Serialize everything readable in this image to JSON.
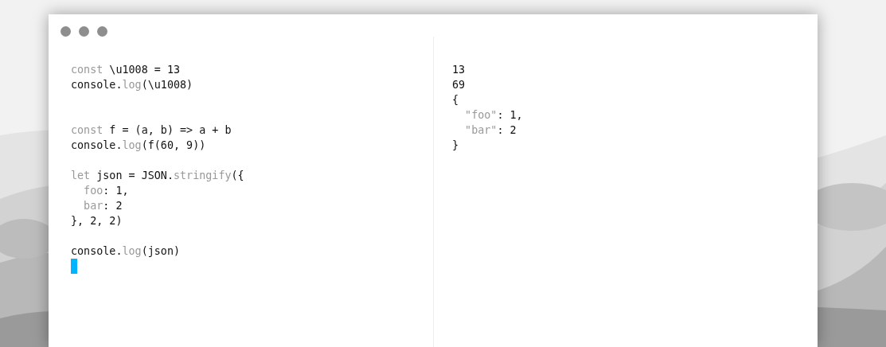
{
  "window": {
    "controls": [
      {
        "kind": "dot"
      },
      {
        "kind": "dot"
      },
      {
        "kind": "dot"
      }
    ]
  },
  "editor": {
    "lines": [
      {
        "kind": "code",
        "segments": [
          {
            "text": "const",
            "kind": "dim"
          },
          {
            "text": " \\u1008 = 13",
            "kind": "plain"
          }
        ]
      },
      {
        "kind": "code",
        "segments": [
          {
            "text": "console.",
            "kind": "plain"
          },
          {
            "text": "log",
            "kind": "dim"
          },
          {
            "text": "(\\u1008)",
            "kind": "plain"
          }
        ]
      },
      {
        "kind": "blank"
      },
      {
        "kind": "blank"
      },
      {
        "kind": "code",
        "segments": [
          {
            "text": "const",
            "kind": "dim"
          },
          {
            "text": " f = (a, b) => a + b",
            "kind": "plain"
          }
        ]
      },
      {
        "kind": "code",
        "segments": [
          {
            "text": "console.",
            "kind": "plain"
          },
          {
            "text": "log",
            "kind": "dim"
          },
          {
            "text": "(f(60, 9))",
            "kind": "plain"
          }
        ]
      },
      {
        "kind": "blank"
      },
      {
        "kind": "code",
        "segments": [
          {
            "text": "let",
            "kind": "dim"
          },
          {
            "text": " json = JSON.",
            "kind": "plain"
          },
          {
            "text": "stringify",
            "kind": "dim"
          },
          {
            "text": "({",
            "kind": "plain"
          }
        ]
      },
      {
        "kind": "code",
        "segments": [
          {
            "text": "  foo",
            "kind": "dim"
          },
          {
            "text": ": 1,",
            "kind": "plain"
          }
        ]
      },
      {
        "kind": "code",
        "segments": [
          {
            "text": "  bar",
            "kind": "dim"
          },
          {
            "text": ": 2",
            "kind": "plain"
          }
        ]
      },
      {
        "kind": "code",
        "segments": [
          {
            "text": "}, 2, 2)",
            "kind": "plain"
          }
        ]
      },
      {
        "kind": "blank"
      },
      {
        "kind": "code",
        "segments": [
          {
            "text": "console.",
            "kind": "plain"
          },
          {
            "text": "log",
            "kind": "dim"
          },
          {
            "text": "(json)",
            "kind": "plain"
          }
        ]
      }
    ],
    "cursor_visible": true
  },
  "output": {
    "lines": [
      {
        "kind": "code",
        "segments": [
          {
            "text": "13",
            "kind": "plain"
          }
        ]
      },
      {
        "kind": "code",
        "segments": [
          {
            "text": "69",
            "kind": "plain"
          }
        ]
      },
      {
        "kind": "code",
        "segments": [
          {
            "text": "{",
            "kind": "plain"
          }
        ]
      },
      {
        "kind": "code",
        "segments": [
          {
            "text": "  \"foo\"",
            "kind": "dim"
          },
          {
            "text": ": 1,",
            "kind": "plain"
          }
        ]
      },
      {
        "kind": "code",
        "segments": [
          {
            "text": "  \"bar\"",
            "kind": "dim"
          },
          {
            "text": ": 2",
            "kind": "plain"
          }
        ]
      },
      {
        "kind": "code",
        "segments": [
          {
            "text": "}",
            "kind": "plain"
          }
        ]
      }
    ]
  }
}
